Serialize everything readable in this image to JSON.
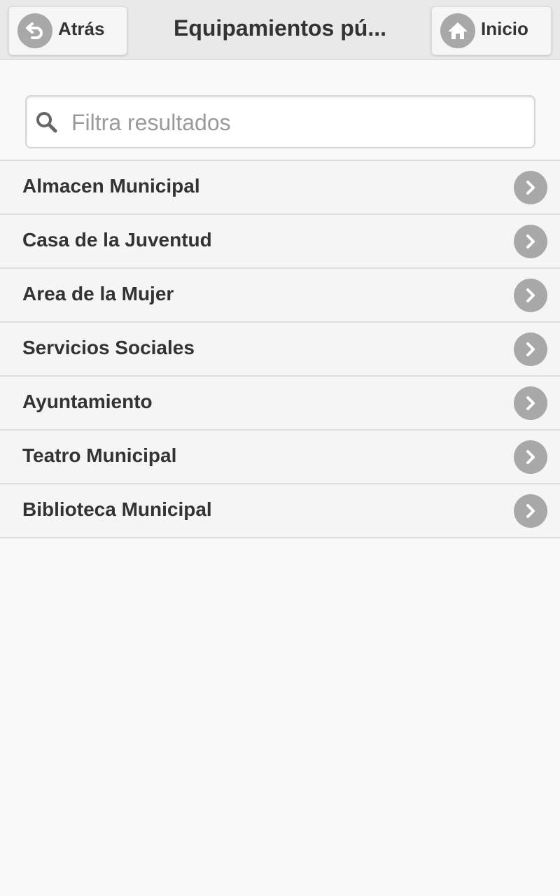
{
  "header": {
    "title": "Equipamientos pú...",
    "back_label": "Atrás",
    "home_label": "Inicio"
  },
  "search": {
    "placeholder": "Filtra resultados",
    "value": ""
  },
  "list": {
    "items": [
      {
        "label": "Almacen Municipal"
      },
      {
        "label": "Casa de la Juventud"
      },
      {
        "label": "Area de la Mujer"
      },
      {
        "label": "Servicios Sociales"
      },
      {
        "label": "Ayuntamiento"
      },
      {
        "label": "Teatro Municipal"
      },
      {
        "label": "Biblioteca Municipal"
      }
    ]
  },
  "icons": {
    "back": "back-arrow-icon",
    "home": "home-icon",
    "search": "search-icon",
    "chevron": "chevron-right-icon"
  },
  "colors": {
    "header_bg": "#e9e9e9",
    "list_bg": "#f5f5f5",
    "icon_circle": "#a8a8a8",
    "text": "#333333",
    "placeholder": "#9a9a9a"
  }
}
